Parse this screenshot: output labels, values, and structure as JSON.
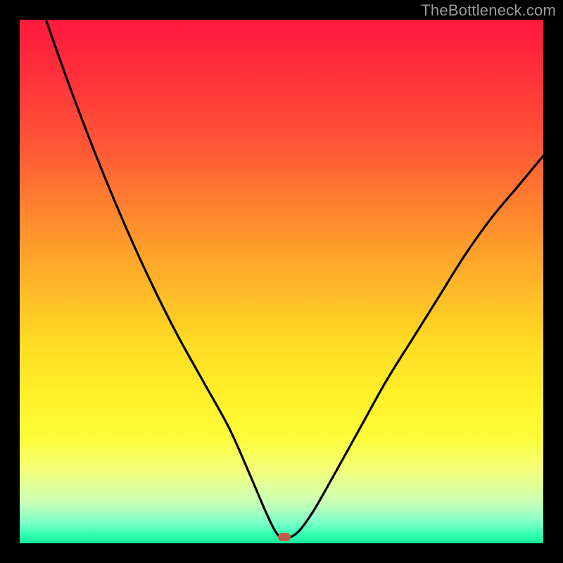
{
  "watermark": "TheBottleneck.com",
  "marker": {
    "x_pct": 50.5,
    "y_pct": 98.8,
    "color": "#c45a4a"
  },
  "chart_data": {
    "type": "line",
    "title": "",
    "xlabel": "",
    "ylabel": "",
    "xlim": [
      0,
      100
    ],
    "ylim": [
      0,
      100
    ],
    "grid": false,
    "legend": false,
    "series": [
      {
        "name": "bottleneck-curve",
        "x": [
          5,
          10,
          15,
          20,
          25,
          30,
          35,
          40,
          44,
          47,
          49,
          50.5,
          53,
          56,
          60,
          65,
          70,
          75,
          80,
          85,
          90,
          95,
          100
        ],
        "y": [
          100,
          86,
          73,
          61,
          50,
          40,
          31,
          22,
          13,
          6,
          2,
          1,
          2,
          6,
          13,
          22,
          31,
          39,
          47,
          55,
          62,
          68,
          74
        ]
      }
    ],
    "annotations": [
      {
        "type": "marker",
        "x": 50.5,
        "y": 1,
        "label": "optimal-point"
      }
    ],
    "background_gradient": {
      "direction": "vertical",
      "stops": [
        {
          "pct": 0,
          "color": "#ff1a3f"
        },
        {
          "pct": 25,
          "color": "#ff5a36"
        },
        {
          "pct": 50,
          "color": "#ffb428"
        },
        {
          "pct": 72,
          "color": "#fff02a"
        },
        {
          "pct": 92,
          "color": "#ccffb6"
        },
        {
          "pct": 100,
          "color": "#18e89a"
        }
      ]
    }
  }
}
